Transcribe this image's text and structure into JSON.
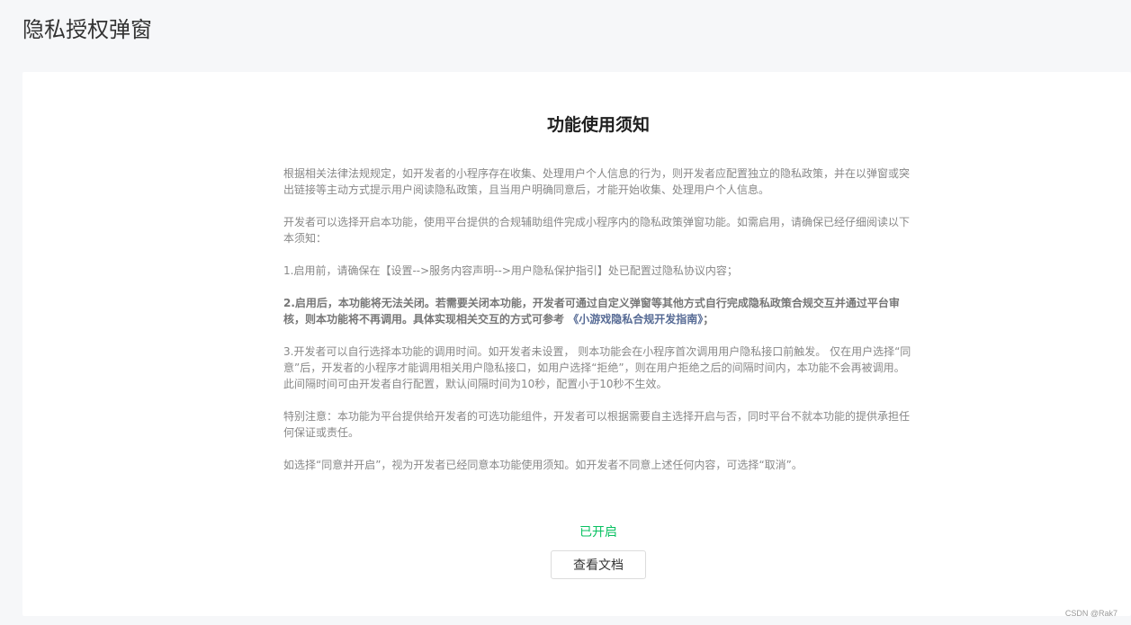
{
  "page": {
    "title": "隐私授权弹窗"
  },
  "notice": {
    "title": "功能使用须知",
    "p1": "根据相关法律法规规定，如开发者的小程序存在收集、处理用户个人信息的行为，则开发者应配置独立的隐私政策，并在以弹窗或突出链接等主动方式提示用户阅读隐私政策，且当用户明确同意后，才能开始收集、处理用户个人信息。",
    "p2": "开发者可以选择开启本功能，使用平台提供的合规辅助组件完成小程序内的隐私政策弹窗功能。如需启用，请确保已经仔细阅读以下本须知：",
    "p3": "1.启用前，请确保在【设置-->服务内容声明-->用户隐私保护指引】处已配置过隐私协议内容；",
    "p4_text": "2.启用后，本功能将无法关闭。若需要关闭本功能，开发者可通过自定义弹窗等其他方式自行完成隐私政策合规交互并通过平台审核，则本功能将不再调用。具体实现相关交互的方式可参考 ",
    "p4_link": "《小游戏隐私合规开发指南》",
    "p4_tail": "；",
    "p5": "3.开发者可以自行选择本功能的调用时间。如开发者未设置， 则本功能会在小程序首次调用用户隐私接口前触发。 仅在用户选择“同意”后，开发者的小程序才能调用相关用户隐私接口，如用户选择“拒绝”，则在用户拒绝之后的间隔时间内，本功能不会再被调用。此间隔时间可由开发者自行配置，默认间隔时间为10秒，配置小于10秒不生效。",
    "p6": "特别注意：本功能为平台提供给开发者的可选功能组件，开发者可以根据需要自主选择开启与否，同时平台不就本功能的提供承担任何保证或责任。",
    "p7": "如选择“同意并开启”，视为开发者已经同意本功能使用须知。如开发者不同意上述任何内容，可选择“取消”。"
  },
  "status": {
    "label": "已开启",
    "color": "#07c160"
  },
  "actions": {
    "view_docs_label": "查看文档"
  },
  "watermark": {
    "text": "CSDN @Rak7"
  }
}
